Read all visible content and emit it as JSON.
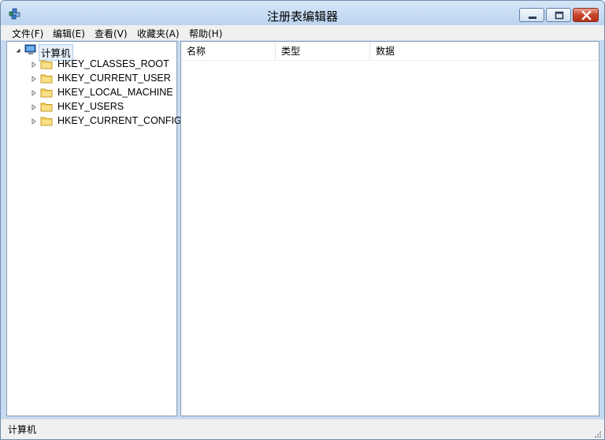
{
  "window": {
    "title": "注册表编辑器"
  },
  "menu": [
    "文件(F)",
    "编辑(E)",
    "查看(V)",
    "收藏夹(A)",
    "帮助(H)"
  ],
  "tree": {
    "root": "计算机",
    "children": [
      "HKEY_CLASSES_ROOT",
      "HKEY_CURRENT_USER",
      "HKEY_LOCAL_MACHINE",
      "HKEY_USERS",
      "HKEY_CURRENT_CONFIG"
    ]
  },
  "list": {
    "columns": [
      "名称",
      "类型",
      "数据"
    ]
  },
  "status": {
    "text": "计算机"
  },
  "icons": {
    "app": "registry-editor-icon",
    "root": "computer-icon",
    "hive": "folder-icon",
    "expand": "triangle-right-icon",
    "collapse": "triangle-down-icon"
  },
  "colors": {
    "close_button": "#c7432b",
    "title_bar": "#bcd4ef",
    "selection_border": "#7aa7d6"
  }
}
